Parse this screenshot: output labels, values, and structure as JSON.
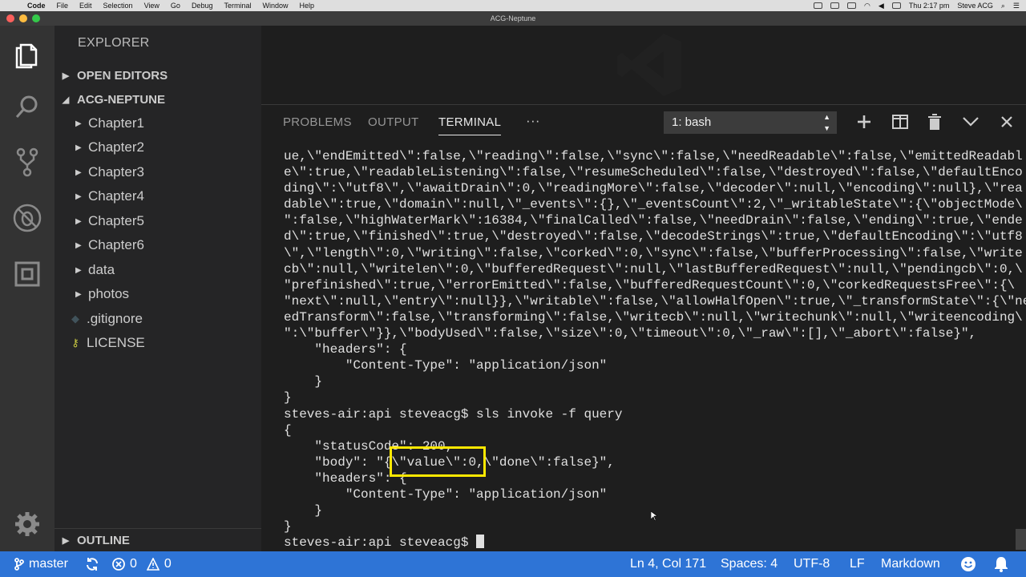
{
  "menubar": {
    "app": "Code",
    "items": [
      "File",
      "Edit",
      "Selection",
      "View",
      "Go",
      "Debug",
      "Terminal",
      "Window",
      "Help"
    ],
    "clock": "Thu 2:17 pm",
    "user": "Steve ACG"
  },
  "window": {
    "title": "ACG-Neptune"
  },
  "sidebar": {
    "title": "EXPLORER",
    "open_editors": "OPEN EDITORS",
    "project": "ACG-NEPTUNE",
    "items": [
      {
        "label": "Chapter1",
        "type": "folder"
      },
      {
        "label": "Chapter2",
        "type": "folder"
      },
      {
        "label": "Chapter3",
        "type": "folder"
      },
      {
        "label": "Chapter4",
        "type": "folder"
      },
      {
        "label": "Chapter5",
        "type": "folder"
      },
      {
        "label": "Chapter6",
        "type": "folder"
      },
      {
        "label": "data",
        "type": "folder"
      },
      {
        "label": "photos",
        "type": "folder"
      },
      {
        "label": ".gitignore",
        "type": "file",
        "icon": "git-file-icon"
      },
      {
        "label": "LICENSE",
        "type": "file",
        "icon": "license-icon"
      }
    ],
    "outline": "OUTLINE"
  },
  "panel": {
    "tabs": [
      "PROBLEMS",
      "OUTPUT",
      "TERMINAL"
    ],
    "active_tab": "TERMINAL",
    "more": "···",
    "terminal_select": "1: bash",
    "terminal_lines": [
      "ue,\\\"endEmitted\\\":false,\\\"reading\\\":false,\\\"sync\\\":false,\\\"needReadable\\\":false,\\\"emittedReadabl",
      "e\\\":true,\\\"readableListening\\\":false,\\\"resumeScheduled\\\":false,\\\"destroyed\\\":false,\\\"defaultEnco",
      "ding\\\":\\\"utf8\\\",\\\"awaitDrain\\\":0,\\\"readingMore\\\":false,\\\"decoder\\\":null,\\\"encoding\\\":null},\\\"rea",
      "dable\\\":true,\\\"domain\\\":null,\\\"_events\\\":{},\\\"_eventsCount\\\":2,\\\"_writableState\\\":{\\\"objectMode\\",
      "\":false,\\\"highWaterMark\\\":16384,\\\"finalCalled\\\":false,\\\"needDrain\\\":false,\\\"ending\\\":true,\\\"ende",
      "d\\\":true,\\\"finished\\\":true,\\\"destroyed\\\":false,\\\"decodeStrings\\\":true,\\\"defaultEncoding\\\":\\\"utf8",
      "\\\",\\\"length\\\":0,\\\"writing\\\":false,\\\"corked\\\":0,\\\"sync\\\":false,\\\"bufferProcessing\\\":false,\\\"write",
      "cb\\\":null,\\\"writelen\\\":0,\\\"bufferedRequest\\\":null,\\\"lastBufferedRequest\\\":null,\\\"pendingcb\\\":0,\\",
      "\"prefinished\\\":true,\\\"errorEmitted\\\":false,\\\"bufferedRequestCount\\\":0,\\\"corkedRequestsFree\\\":{\\",
      "\"next\\\":null,\\\"entry\\\":null}},\\\"writable\\\":false,\\\"allowHalfOpen\\\":true,\\\"_transformState\\\":{\\\"ne",
      "edTransform\\\":false,\\\"transforming\\\":false,\\\"writecb\\\":null,\\\"writechunk\\\":null,\\\"writeencoding\\",
      "\":\\\"buffer\\\"}},\\\"bodyUsed\\\":false,\\\"size\\\":0,\\\"timeout\\\":0,\\\"_raw\\\":[],\\\"_abort\\\":false}\",",
      "    \"headers\": {",
      "        \"Content-Type\": \"application/json\"",
      "    }",
      "}",
      "steves-air:api steveacg$ sls invoke -f query",
      "{",
      "    \"statusCode\": 200,",
      "    \"body\": \"{\\\"value\\\":0,\\\"done\\\":false}\",",
      "    \"headers\": {",
      "        \"Content-Type\": \"application/json\"",
      "    }",
      "}",
      "steves-air:api steveacg$ "
    ]
  },
  "statusbar": {
    "branch": "master",
    "errors": "0",
    "warnings": "0",
    "position": "Ln 4, Col 171",
    "spaces": "Spaces: 4",
    "encoding": "UTF-8",
    "eol": "LF",
    "language": "Markdown"
  },
  "colors": {
    "statusbar": "#2e74d6",
    "highlight": "#ffe800",
    "activity_bar": "#333333",
    "sidebar": "#252526"
  }
}
